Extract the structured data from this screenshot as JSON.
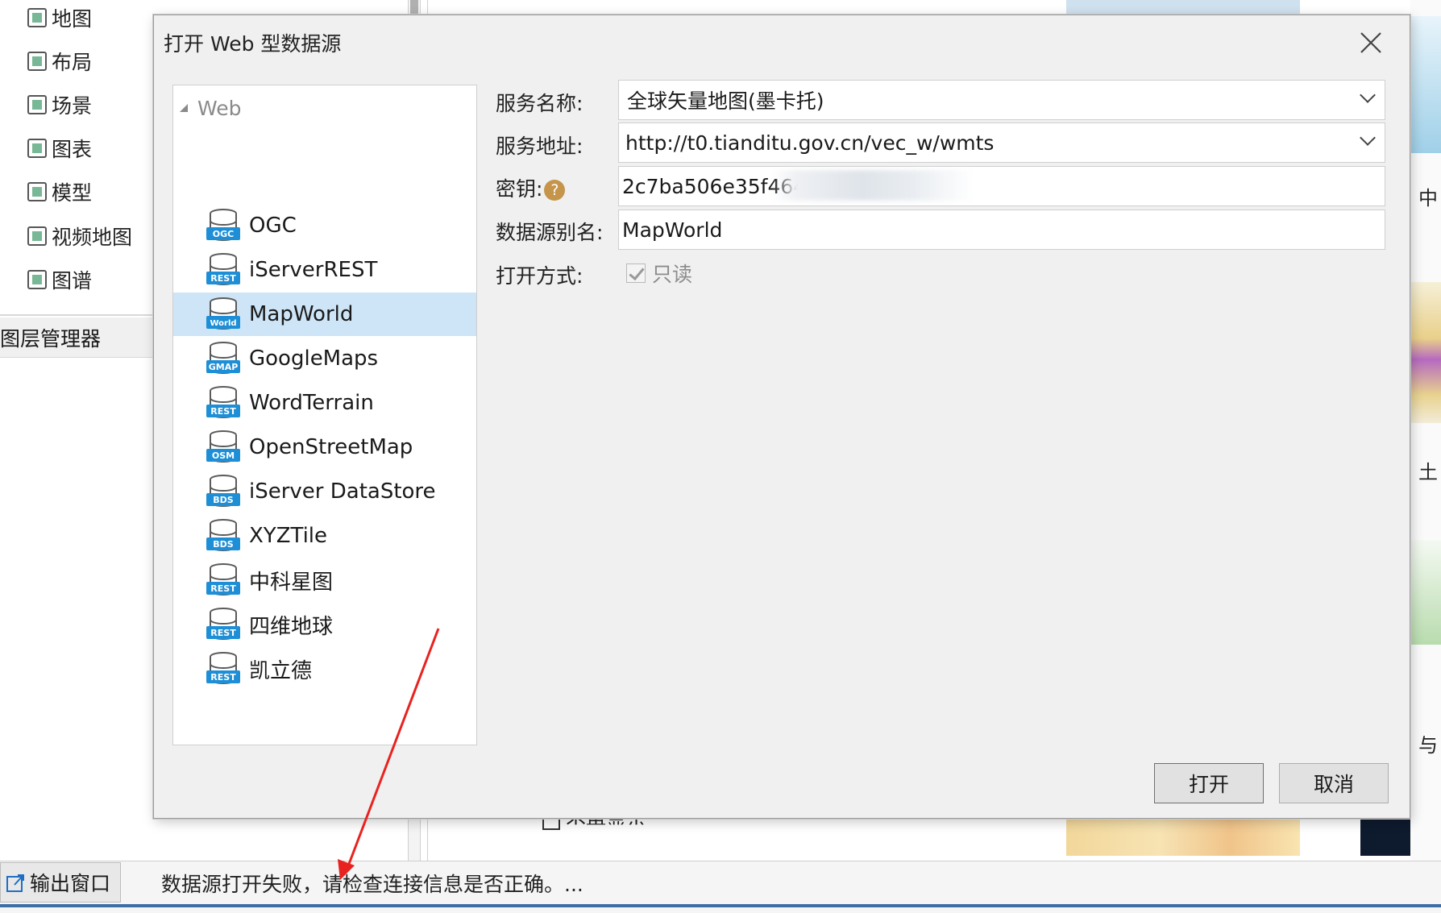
{
  "sidebar": {
    "items": [
      {
        "label": "地图",
        "icon": "map-icon"
      },
      {
        "label": "布局",
        "icon": "layout-icon"
      },
      {
        "label": "场景",
        "icon": "scene-icon"
      },
      {
        "label": "图表",
        "icon": "chart-icon"
      },
      {
        "label": "模型",
        "icon": "model-icon"
      },
      {
        "label": "视频地图",
        "icon": "video-map-icon"
      },
      {
        "label": "图谱",
        "icon": "graph-icon"
      }
    ],
    "layer_manager": "图层管理器"
  },
  "background": {
    "no_show_label": "不再显示",
    "right_edge_chars": [
      "中",
      "土",
      "与"
    ]
  },
  "dialog": {
    "title": "打开 Web 型数据源",
    "close_icon": "close-icon",
    "tree": {
      "root": "Web",
      "items": [
        {
          "label": "OGC",
          "badge": "OGC"
        },
        {
          "label": "iServerREST",
          "badge": "REST"
        },
        {
          "label": "MapWorld",
          "badge": "World",
          "selected": true
        },
        {
          "label": "GoogleMaps",
          "badge": "GMAP"
        },
        {
          "label": "WordTerrain",
          "badge": "REST"
        },
        {
          "label": "OpenStreetMap",
          "badge": "OSM"
        },
        {
          "label": "iServer DataStore",
          "badge": "BDS"
        },
        {
          "label": "XYZTile",
          "badge": "BDS"
        },
        {
          "label": "中科星图",
          "badge": "REST"
        },
        {
          "label": "四维地球",
          "badge": "REST"
        },
        {
          "label": "凯立德",
          "badge": "REST"
        }
      ]
    },
    "form": {
      "service_name_label": "服务名称:",
      "service_name_value": "全球矢量地图(墨卡托)",
      "service_url_label": "服务地址:",
      "service_url_value": "http://t0.tianditu.gov.cn/vec_w/wmts",
      "key_label": "密钥:",
      "key_help": "?",
      "key_value": "2c7ba506e35f464",
      "alias_label": "数据源别名:",
      "alias_value": "MapWorld",
      "open_mode_label": "打开方式:",
      "readonly_label": "只读",
      "readonly_checked": true
    },
    "buttons": {
      "open": "打开",
      "cancel": "取消"
    }
  },
  "status_bar": {
    "output_tab": "输出窗口",
    "message": "数据源打开失败，请检查连接信息是否正确。..."
  },
  "colors": {
    "selection": "#cde5f7",
    "db_icon_blue": "#1e8fd6",
    "annotation_arrow": "#e8231f"
  }
}
